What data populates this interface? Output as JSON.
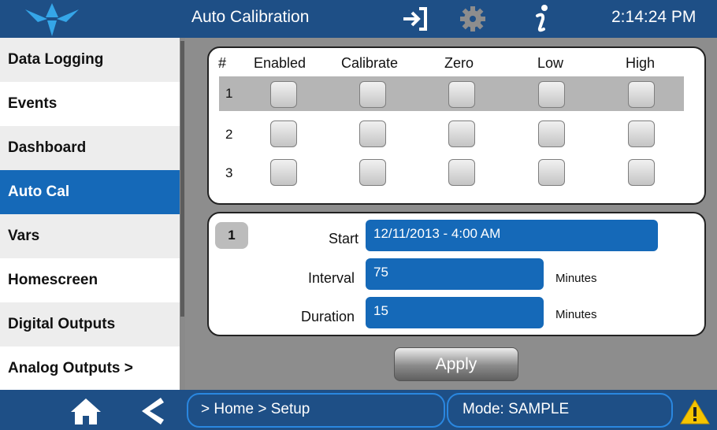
{
  "header": {
    "title": "Auto Calibration",
    "clock": "2:14:24 PM",
    "icons": [
      "logo-icon",
      "exit-icon",
      "gear-icon",
      "info-icon"
    ]
  },
  "sidebar": {
    "items": [
      {
        "label": "Data Logging",
        "active": false
      },
      {
        "label": "Events",
        "active": false
      },
      {
        "label": "Dashboard",
        "active": false
      },
      {
        "label": "Auto Cal",
        "active": true
      },
      {
        "label": "Vars",
        "active": false
      },
      {
        "label": "Homescreen",
        "active": false
      },
      {
        "label": "Digital Outputs",
        "active": false
      },
      {
        "label": "Analog Outputs >",
        "active": false
      }
    ]
  },
  "sequence_table": {
    "headers": [
      "#",
      "Enabled",
      "Calibrate",
      "Zero",
      "Low",
      "High"
    ],
    "rows": [
      {
        "num": "1",
        "selected": true,
        "checks": [
          false,
          false,
          false,
          false,
          false
        ]
      },
      {
        "num": "2",
        "selected": false,
        "checks": [
          false,
          false,
          false,
          false,
          false
        ]
      },
      {
        "num": "3",
        "selected": false,
        "checks": [
          false,
          false,
          false,
          false,
          false
        ]
      }
    ]
  },
  "schedule": {
    "selected_row": "1",
    "start_label": "Start",
    "start_value": "12/11/2013 - 4:00 AM",
    "interval_label": "Interval",
    "interval_value": "75",
    "interval_unit": "Minutes",
    "duration_label": "Duration",
    "duration_value": "15",
    "duration_unit": "Minutes"
  },
  "apply_label": "Apply",
  "footer": {
    "breadcrumb": "> Home > Setup",
    "mode": "Mode: SAMPLE",
    "icons": [
      "home-icon",
      "back-icon",
      "warning-icon"
    ]
  },
  "colors": {
    "bar": "#1e4f86",
    "accent": "#1569b8",
    "panel_bg": "#8d8d8d",
    "warning": "#f5c400"
  }
}
